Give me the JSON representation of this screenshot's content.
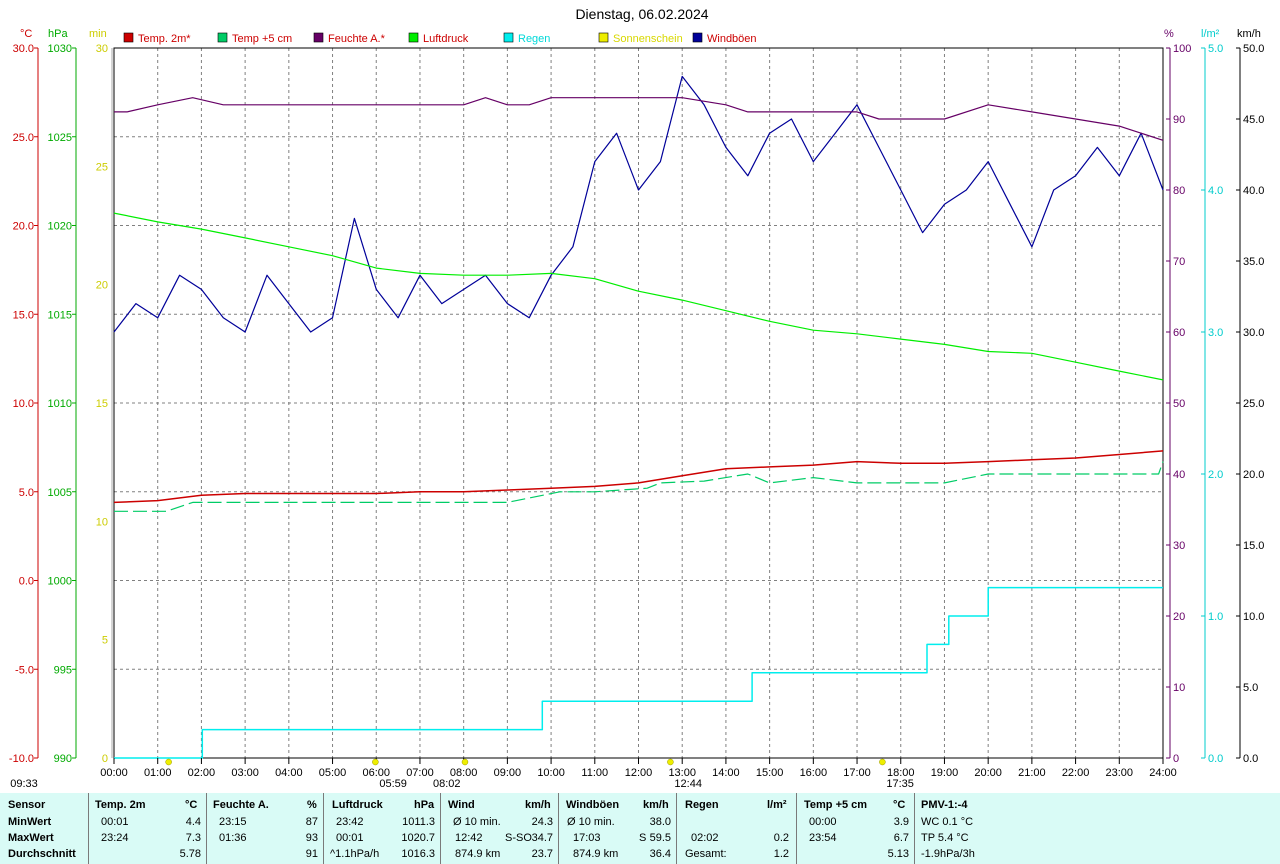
{
  "title": "Dienstag, 06.02.2024",
  "colors": {
    "temp": "#cc0000",
    "temp5": "#00cc66",
    "humidity": "#660066",
    "pressure": "#00ee00",
    "rain": "#00eeee",
    "sun": "#eeee00",
    "gust": "#000099",
    "grid": "#808080"
  },
  "legend": [
    {
      "label": "Temp. 2m*",
      "color": "#cc0000"
    },
    {
      "label": "Temp +5 cm",
      "color": "#00cc66"
    },
    {
      "label": "Feuchte A.*",
      "color": "#660066"
    },
    {
      "label": "Luftdruck",
      "color": "#00ee00"
    },
    {
      "label": "Regen",
      "color": "#00eeee"
    },
    {
      "label": "Sonnenschein",
      "color": "#eeee00"
    },
    {
      "label": "Windböen",
      "color": "#000099"
    }
  ],
  "axis_units": {
    "temp": "°C",
    "pressure": "hPa",
    "sun": "min",
    "humidity": "%",
    "rain": "l/m²",
    "wind": "km/h"
  },
  "chart_data": {
    "type": "line",
    "title": "Dienstag, 06.02.2024",
    "x_ticks": [
      "00:00",
      "01:00",
      "02:00",
      "03:00",
      "04:00",
      "05:00",
      "06:00",
      "07:00",
      "08:00",
      "09:00",
      "10:00",
      "11:00",
      "12:00",
      "13:00",
      "14:00",
      "15:00",
      "16:00",
      "17:00",
      "18:00",
      "19:00",
      "20:00",
      "21:00",
      "22:00",
      "23:00",
      "24:00"
    ],
    "axes": {
      "temp": {
        "min": -10,
        "max": 30,
        "ticks": [
          "-10.0",
          "-5.0",
          "0.0",
          "5.0",
          "10.0",
          "15.0",
          "20.0",
          "25.0",
          "30.0"
        ]
      },
      "pressure": {
        "min": 990,
        "max": 1030,
        "ticks": [
          "990",
          "995",
          "1000",
          "1005",
          "1010",
          "1015",
          "1020",
          "1025",
          "1030"
        ]
      },
      "sun": {
        "min": 0,
        "max": 30,
        "ticks": [
          "0",
          "5",
          "10",
          "15",
          "20",
          "25",
          "30"
        ]
      },
      "humidity": {
        "min": 0,
        "max": 100,
        "ticks": [
          "0",
          "10",
          "20",
          "30",
          "40",
          "50",
          "60",
          "70",
          "80",
          "90",
          "100"
        ]
      },
      "rain": {
        "min": 0,
        "max": 5,
        "ticks": [
          "0.0",
          "1.0",
          "2.0",
          "3.0",
          "4.0",
          "5.0"
        ]
      },
      "wind": {
        "min": 0,
        "max": 50,
        "ticks": [
          "0.0",
          "5.0",
          "10.0",
          "15.0",
          "20.0",
          "25.0",
          "30.0",
          "35.0",
          "40.0",
          "45.0",
          "50.0"
        ]
      }
    },
    "series": [
      {
        "name": "Temp. 2m*",
        "axis": "temp",
        "x": [
          0,
          1,
          2,
          3,
          4,
          5,
          6,
          7,
          8,
          9,
          10,
          11,
          12,
          13,
          14,
          15,
          16,
          17,
          18,
          19,
          20,
          21,
          22,
          23,
          24
        ],
        "values": [
          4.4,
          4.5,
          4.8,
          4.9,
          4.9,
          4.9,
          4.9,
          5.0,
          5.0,
          5.1,
          5.2,
          5.3,
          5.5,
          5.9,
          6.3,
          6.4,
          6.5,
          6.7,
          6.6,
          6.6,
          6.7,
          6.8,
          6.9,
          7.1,
          7.3
        ]
      },
      {
        "name": "Temp +5 cm",
        "axis": "temp",
        "x": [
          0,
          1.2,
          1.8,
          3,
          5,
          7,
          9,
          10.2,
          11,
          12.2,
          12.5,
          13.5,
          14.5,
          15,
          16,
          17,
          18,
          19,
          20,
          21,
          22,
          23,
          23.9,
          24
        ],
        "values": [
          3.9,
          3.9,
          4.4,
          4.4,
          4.4,
          4.4,
          4.4,
          5.0,
          5.0,
          5.2,
          5.5,
          5.6,
          6.0,
          5.5,
          5.8,
          5.5,
          5.5,
          5.5,
          6.0,
          6.0,
          6.0,
          6.0,
          6.0,
          6.7
        ]
      },
      {
        "name": "Feuchte A.*",
        "axis": "humidity",
        "x": [
          0,
          0.3,
          1,
          1.8,
          2.5,
          3,
          4,
          5,
          6,
          7,
          8,
          8.5,
          9,
          9.5,
          10,
          11,
          12,
          13,
          14,
          14.5,
          15,
          16,
          17,
          17.5,
          18,
          19,
          20,
          21,
          22,
          23,
          23.5,
          24
        ],
        "values": [
          91,
          91,
          92,
          93,
          92,
          92,
          92,
          92,
          92,
          92,
          92,
          93,
          92,
          92,
          93,
          93,
          93,
          93,
          92,
          91,
          91,
          91,
          91,
          90,
          90,
          90,
          92,
          91,
          90,
          89,
          88,
          87
        ]
      },
      {
        "name": "Luftdruck",
        "axis": "pressure",
        "x": [
          0,
          1,
          2,
          3,
          4,
          5,
          6,
          7,
          8,
          9,
          10,
          11,
          12,
          13,
          14,
          15,
          16,
          17,
          18,
          19,
          20,
          21,
          22,
          23,
          24
        ],
        "values": [
          1020.7,
          1020.2,
          1019.8,
          1019.3,
          1018.8,
          1018.3,
          1017.6,
          1017.3,
          1017.2,
          1017.2,
          1017.3,
          1017.0,
          1016.3,
          1015.8,
          1015.2,
          1014.6,
          1014.1,
          1013.9,
          1013.6,
          1013.3,
          1012.9,
          1012.8,
          1012.3,
          1011.8,
          1011.3
        ]
      },
      {
        "name": "Regen",
        "axis": "rain",
        "x": [
          0,
          2.02,
          2.02,
          9.8,
          9.8,
          14.6,
          14.6,
          18.6,
          18.6,
          19.1,
          19.1,
          20.0,
          20.0,
          24
        ],
        "values": [
          0,
          0,
          0.2,
          0.2,
          0.4,
          0.4,
          0.6,
          0.6,
          0.8,
          0.8,
          1.0,
          1.0,
          1.2,
          1.2
        ]
      },
      {
        "name": "Windböen",
        "axis": "wind",
        "x": [
          0,
          0.5,
          1,
          1.5,
          2,
          2.5,
          3,
          3.5,
          4,
          4.5,
          5,
          5.5,
          6,
          6.5,
          7,
          7.5,
          8,
          8.5,
          9,
          9.5,
          10,
          10.5,
          11,
          11.5,
          12,
          12.5,
          13,
          13.5,
          14,
          14.5,
          15,
          15.5,
          16,
          16.5,
          17,
          17.5,
          18,
          18.5,
          19,
          19.5,
          20,
          20.5,
          21,
          21.5,
          22,
          22.5,
          23,
          23.5,
          24
        ],
        "values": [
          30,
          32,
          31,
          34,
          33,
          31,
          30,
          34,
          32,
          30,
          31,
          38,
          33,
          31,
          34,
          32,
          33,
          34,
          32,
          31,
          34,
          36,
          42,
          44,
          40,
          42,
          48,
          46,
          43,
          41,
          44,
          45,
          42,
          44,
          46,
          43,
          40,
          37,
          39,
          40,
          42,
          39,
          36,
          40,
          41,
          43,
          41,
          44,
          40
        ]
      }
    ],
    "sun_markers": [
      {
        "x": 1.25,
        "label": "09:33"
      },
      {
        "x": 5.98,
        "label": "05:59"
      },
      {
        "x": 8.03,
        "label": "08:02"
      },
      {
        "x": 12.73,
        "label": "12:44"
      },
      {
        "x": 17.58,
        "label": "17:35"
      }
    ]
  },
  "table": {
    "row_labels": [
      "Sensor",
      "MinWert",
      "MaxWert",
      "Durchschnitt"
    ],
    "temp2m": {
      "header": "Temp. 2m",
      "unit": "°C",
      "min_time": "00:01",
      "min_val": "4.4",
      "max_time": "23:24",
      "max_val": "7.3",
      "avg": "5.78"
    },
    "humidity": {
      "header": "Feuchte A.",
      "unit": "%",
      "min_time": "23:15",
      "min_val": "87",
      "max_time": "01:36",
      "max_val": "93",
      "avg": "91"
    },
    "pressure": {
      "header": "Luftdruck",
      "unit": "hPa",
      "min_time": "23:42",
      "min_val": "1011.3",
      "max_time": "00:01",
      "max_val": "1020.7",
      "trend": "^1.1hPa/h",
      "avg": "1016.3"
    },
    "wind": {
      "header": "Wind",
      "unit": "km/h",
      "r1_label": "Ø 10 min.",
      "r1_val": "24.3",
      "r2_time": "12:42",
      "r2_dir": "S-SO",
      "r2_val": "34.7",
      "r3_dist": "874.9 km",
      "r3_val": "23.7"
    },
    "gusts": {
      "header": "Windböen",
      "unit": "km/h",
      "r1_label": "Ø 10 min.",
      "r1_val": "38.0",
      "r2_time": "17:03",
      "r2_dir": "S",
      "r2_val": "59.5",
      "r3_dist": "874.9 km",
      "r3_val": "36.4"
    },
    "rain": {
      "header": "Regen",
      "unit": "l/m²",
      "r2_time": "02:02",
      "r2_val": "0.2",
      "r3_label": "Gesamt:",
      "r3_val": "1.2"
    },
    "temp5": {
      "header": "Temp +5 cm",
      "unit": "°C",
      "min_time": "00:00",
      "min_val": "3.9",
      "max_time": "23:54",
      "max_val": "6.7",
      "avg": "5.13"
    },
    "pmv": {
      "header": "PMV-1:-4",
      "r1": "WC 0.1 °C",
      "r2": "TP 5.4 °C",
      "r3": "-1.9hPa/3h"
    }
  }
}
